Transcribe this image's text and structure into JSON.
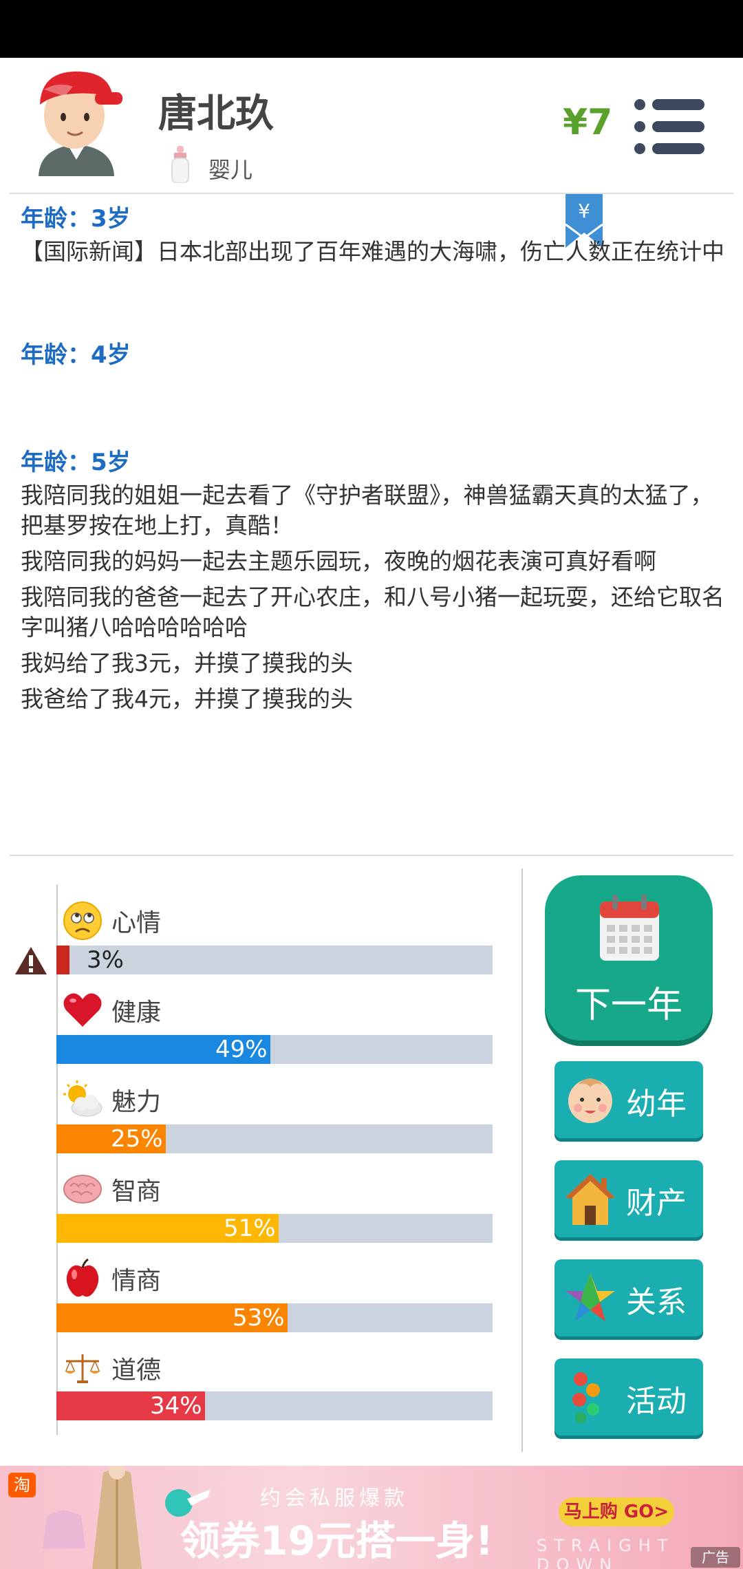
{
  "header": {
    "name": "唐北玖",
    "stage": "婴儿",
    "money": "¥7"
  },
  "log": [
    {
      "age": "年龄：3岁",
      "entries": [
        "【国际新闻】日本北部出现了百年难遇的大海啸，伤亡人数正在统计中"
      ]
    },
    {
      "age": "年龄：4岁",
      "entries": []
    },
    {
      "age": "年龄：5岁",
      "entries": [
        "我陪同我的姐姐一起去看了《守护者联盟》，神兽猛霸天真的太猛了，把基罗按在地上打，真酷！",
        "我陪同我的妈妈一起去主题乐园玩，夜晚的烟花表演可真好看啊",
        "我陪同我的爸爸一起去了开心农庄，和八号小猪一起玩耍，还给它取名字叫猪八哈哈哈哈哈哈",
        "我妈给了我3元，并摸了摸我的头",
        "我爸给了我4元，并摸了摸我的头"
      ]
    }
  ],
  "stats": [
    {
      "name": "心情",
      "value": 3,
      "label": "3%",
      "color": "#c8281e",
      "icon": "sad-face-icon"
    },
    {
      "name": "健康",
      "value": 49,
      "label": "49%",
      "color": "#1a87e0",
      "icon": "heart-icon"
    },
    {
      "name": "魅力",
      "value": 25,
      "label": "25%",
      "color": "#fb8500",
      "icon": "sun-cloud-icon"
    },
    {
      "name": "智商",
      "value": 51,
      "label": "51%",
      "color": "#ffb703",
      "icon": "brain-icon"
    },
    {
      "name": "情商",
      "value": 53,
      "label": "53%",
      "color": "#fb8500",
      "icon": "apple-icon"
    },
    {
      "name": "道德",
      "value": 34,
      "label": "34%",
      "color": "#e63946",
      "icon": "scales-icon"
    }
  ],
  "actions": {
    "next_year": "下一年",
    "childhood": "幼年",
    "property": "财产",
    "relations": "关系",
    "activities": "活动"
  },
  "ad": {
    "badge": "淘",
    "subtitle": "约会私服爆款",
    "headline": "领券19元搭一身!",
    "cta": "马上购 GO>",
    "english": "STRAIGHT DOWN",
    "tag": "广告"
  }
}
